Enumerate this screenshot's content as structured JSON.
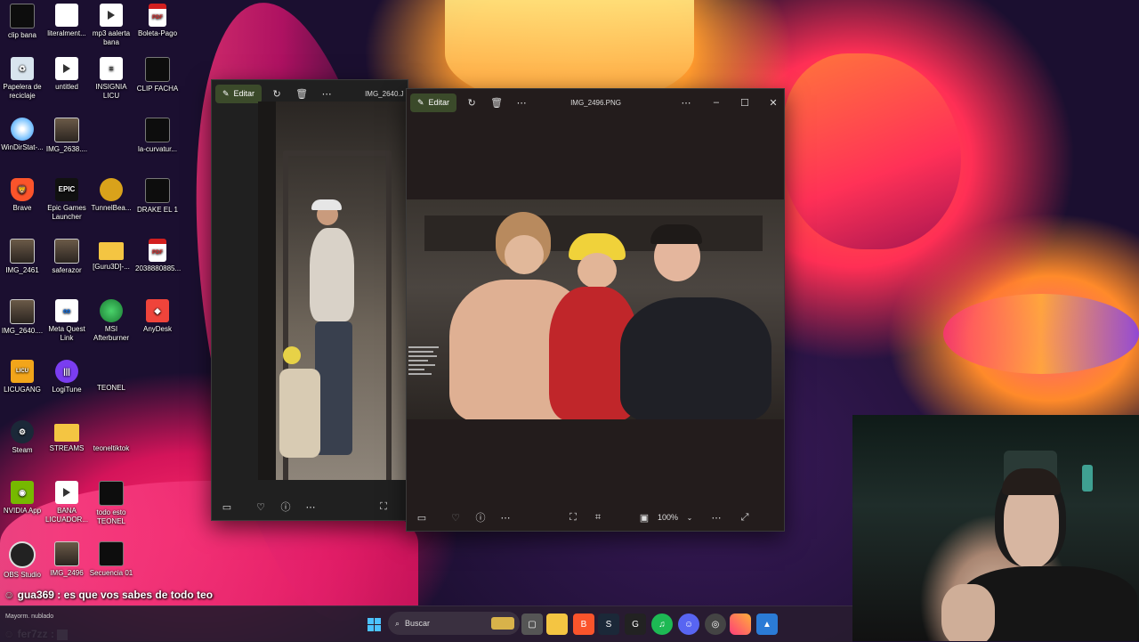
{
  "desktop_icons": [
    {
      "label": "clip bana",
      "icon": "video-thumb-icon"
    },
    {
      "label": "literalment...",
      "icon": "file-icon"
    },
    {
      "label": "mp3 aalerta bana",
      "icon": "media-file-icon"
    },
    {
      "label": "Boleta-Pago",
      "icon": "pdf-icon"
    },
    {
      "label": "Papelera de reciclaje",
      "icon": "recycle-bin-icon"
    },
    {
      "label": "untitled",
      "icon": "media-file-icon"
    },
    {
      "label": "INSIGNIA LICU",
      "icon": "document-icon"
    },
    {
      "label": "CLIP FACHA",
      "icon": "video-thumb-icon"
    },
    {
      "label": "WinDirStat-...",
      "icon": "disc-icon"
    },
    {
      "label": "IMG_2638....",
      "icon": "photo-icon"
    },
    {
      "label": "la-curvatur...",
      "icon": "image-icon"
    },
    {
      "label": "Brave",
      "icon": "brave-icon"
    },
    {
      "label": "Epic Games Launcher",
      "icon": "epic-games-icon"
    },
    {
      "label": "TunnelBea...",
      "icon": "tunnelbear-icon"
    },
    {
      "label": "DRAKE EL 1",
      "icon": "video-thumb-icon"
    },
    {
      "label": "IMG_2461",
      "icon": "photo-icon"
    },
    {
      "label": "saferazor",
      "icon": "photo-icon"
    },
    {
      "label": "[Guru3D]-...",
      "icon": "folder-icon"
    },
    {
      "label": "2038880885...",
      "icon": "pdf-icon"
    },
    {
      "label": "IMG_2640....",
      "icon": "photo-icon"
    },
    {
      "label": "Meta Quest Link",
      "icon": "meta-icon"
    },
    {
      "label": "MSI Afterburner",
      "icon": "msi-icon"
    },
    {
      "label": "AnyDesk",
      "icon": "anydesk-icon"
    },
    {
      "label": "LICUGANG",
      "icon": "licugang-icon"
    },
    {
      "label": "LogiTune",
      "icon": "logitune-icon"
    },
    {
      "label": "TEONEL",
      "icon": "folder-icon"
    },
    {
      "label": "Steam",
      "icon": "steam-icon"
    },
    {
      "label": "STREAMS",
      "icon": "folder-icon"
    },
    {
      "label": "teoneltiktok",
      "icon": "folder-icon"
    },
    {
      "label": "NVIDIA App",
      "icon": "nvidia-icon"
    },
    {
      "label": "BANA LICUADOR...",
      "icon": "media-file-icon"
    },
    {
      "label": "todo esto TEONEL",
      "icon": "video-thumb-icon"
    },
    {
      "label": "OBS Studio",
      "icon": "obs-icon"
    },
    {
      "label": "IMG_2496",
      "icon": "photo-icon"
    },
    {
      "label": "Secuencia 01",
      "icon": "video-thumb-icon"
    }
  ],
  "window_back": {
    "edit_label": "Editar",
    "title": "IMG_2640.J"
  },
  "window_front": {
    "edit_label": "Editar",
    "title": "IMG_2496.PNG",
    "zoom": "100%"
  },
  "chat": [
    {
      "user": "gua369",
      "message": "es que vos sabes de todo teo"
    },
    {
      "user": "fer7zz",
      "message": ""
    }
  ],
  "taskbar": {
    "weather": "Mayorm. nublado",
    "search_placeholder": "Buscar"
  }
}
